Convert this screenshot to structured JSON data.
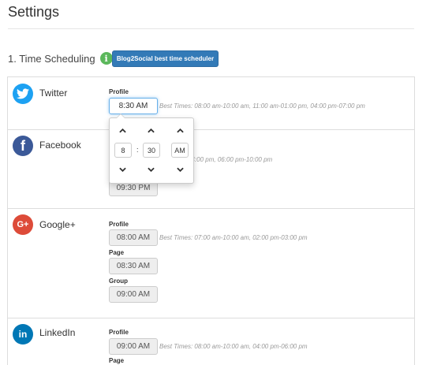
{
  "page": {
    "title": "Settings"
  },
  "section": {
    "title": "1. Time Scheduling",
    "info_icon": "i",
    "best_button": "Blog2Social best time scheduler"
  },
  "networks": {
    "twitter": {
      "name": "Twitter",
      "icon": "twitter-bird-icon",
      "color": "#1da1f2",
      "profile_label": "Profile",
      "profile_time": "8:30 AM",
      "profile_best": "Best Times: 08:00 am-10:00 am, 11:00 am-01:00 pm, 04:00 pm-07:00 pm"
    },
    "facebook": {
      "name": "Facebook",
      "icon": "facebook-f-icon",
      "glyph": "f",
      "color": "#3b5998",
      "best_partial": "01:00 pm-04:00 pm, 06:00 pm-10:00 pm",
      "second_time": "09:30 PM"
    },
    "googleplus": {
      "name": "Google+",
      "icon": "google-plus-icon",
      "glyph": "G+",
      "color": "#dd4b39",
      "profile_label": "Profile",
      "profile_time": "08:00 AM",
      "profile_best": "Best Times: 07:00 am-10:00 am, 02:00 pm-03:00 pm",
      "page_label": "Page",
      "page_time": "08:30 AM",
      "group_label": "Group",
      "group_time": "09:00 AM"
    },
    "linkedin": {
      "name": "LinkedIn",
      "icon": "linkedin-in-icon",
      "glyph": "in",
      "color": "#0077b5",
      "profile_label": "Profile",
      "profile_time": "09:00 AM",
      "profile_best": "Best Times: 08:00 am-10:00 am, 04:00 pm-06:00 pm",
      "page_label": "Page"
    }
  },
  "picker": {
    "hour": "8",
    "separator": ":",
    "minute": "30",
    "meridian": "AM",
    "up": "^",
    "down": "v"
  }
}
